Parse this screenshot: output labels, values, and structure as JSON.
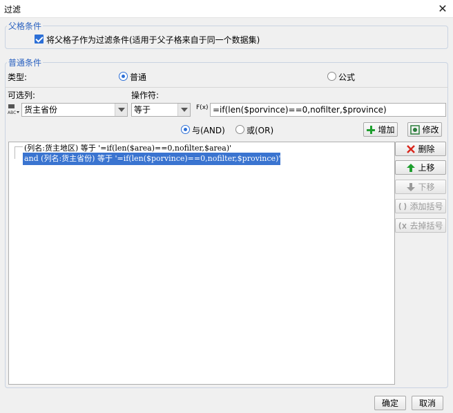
{
  "window": {
    "title": "过滤",
    "close_symbol": "✕"
  },
  "parent_group": {
    "title": "父格条件",
    "checkbox_label": "将父格子作为过滤条件(适用于父子格来自于同一个数据集)",
    "checked": true
  },
  "normal_group": {
    "title": "普通条件",
    "type_label": "类型:",
    "type_options": [
      "普通",
      "公式"
    ],
    "type_selected": "普通",
    "column_label": "可选列:",
    "column_value": "货主省份",
    "operator_label": "操作符:",
    "operator_value": "等于",
    "fx_label": "F(x)",
    "formula_value": "=if(len($porvince)==0,nofilter,$province)",
    "logic_and": "与(AND)",
    "logic_or": "或(OR)",
    "logic_selected": "and",
    "add_label": "增加",
    "modify_label": "修改"
  },
  "conditions": [
    "(列名:货主地区) 等于 '=if(len($area)==0,nofilter,$area)'",
    "and (列名:货主省份) 等于 '=if(len($porvince)==0,nofilter,$province)'"
  ],
  "side_buttons": {
    "delete": "删除",
    "up": "上移",
    "down": "下移",
    "add_bracket": "添加括号",
    "remove_bracket": "去掉括号"
  },
  "footer": {
    "ok": "确定",
    "cancel": "取消"
  },
  "colors": {
    "accent": "#2c6fd6",
    "selection": "#3a74d0",
    "add_icon": "#1e9e2e",
    "delete_icon": "#d9261c"
  }
}
